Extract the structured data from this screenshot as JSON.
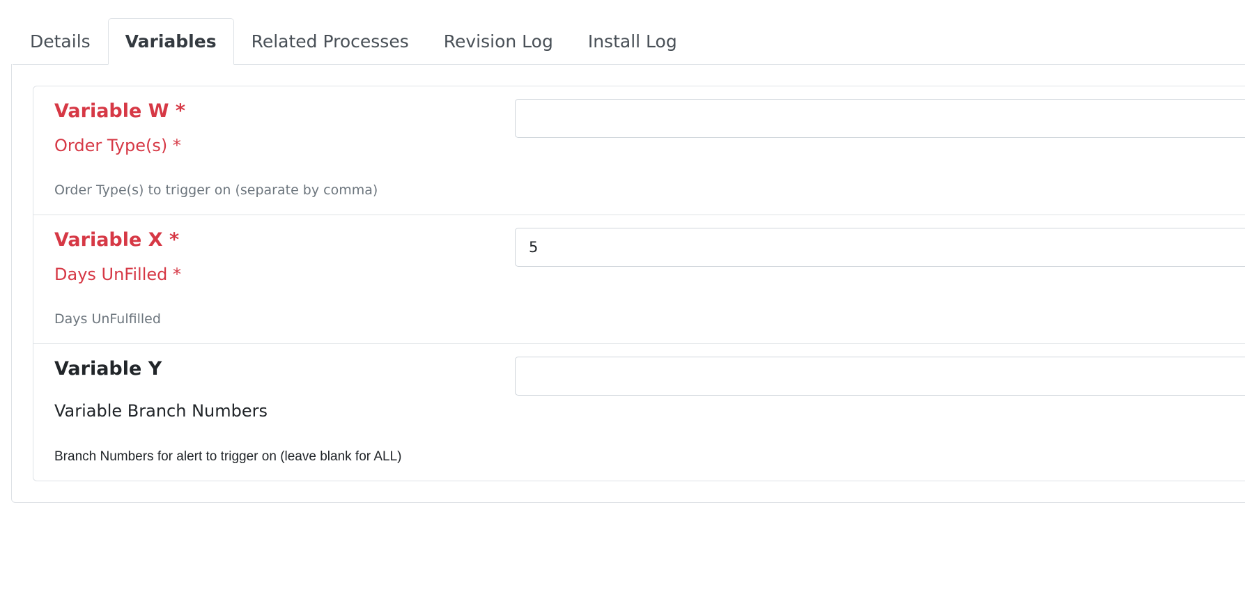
{
  "tabs": [
    {
      "label": "Details",
      "active": false
    },
    {
      "label": "Variables",
      "active": true
    },
    {
      "label": "Related Processes",
      "active": false
    },
    {
      "label": "Revision Log",
      "active": false
    },
    {
      "label": "Install Log",
      "active": false
    }
  ],
  "variables": [
    {
      "title": "Variable W *",
      "subtitle": "Order Type(s) *",
      "help": "Order Type(s) to trigger on (separate by comma)",
      "value": "",
      "required": true
    },
    {
      "title": "Variable X *",
      "subtitle": "Days UnFilled *",
      "help": "Days UnFulfilled",
      "value": "5",
      "required": true
    },
    {
      "title": "Variable Y",
      "subtitle": "Variable Branch Numbers",
      "help": "Branch Numbers for alert to trigger on (leave blank for ALL)",
      "value": "",
      "required": false
    }
  ],
  "colors": {
    "required": "#d63845",
    "help_text": "#6c757d",
    "border": "#dee2e6",
    "input_border": "#ced4da"
  }
}
